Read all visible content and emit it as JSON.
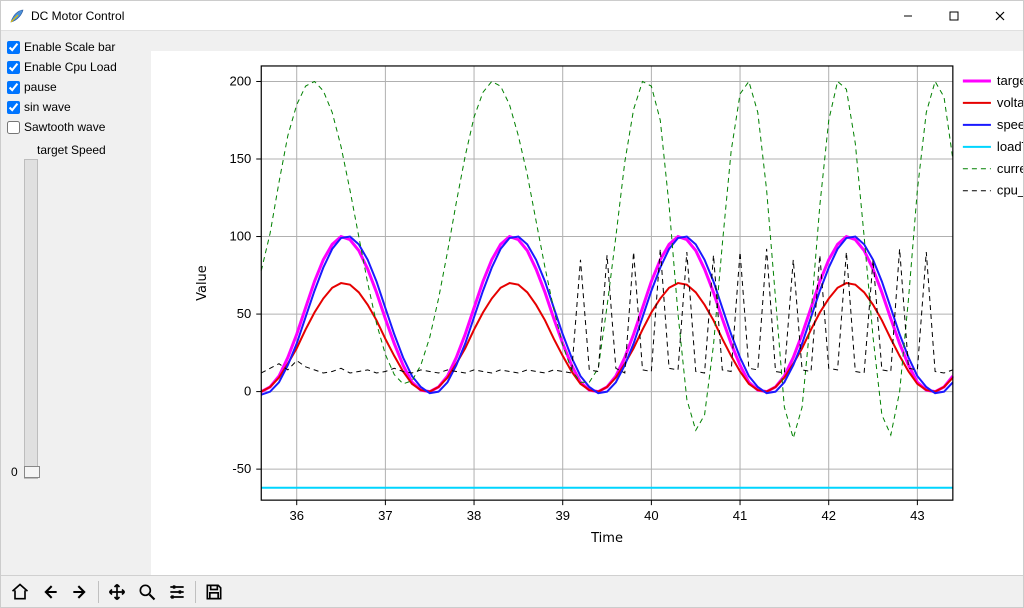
{
  "window": {
    "title": "DC Motor Control"
  },
  "sidebar": {
    "checkboxes": [
      {
        "label": "Enable Scale bar",
        "checked": true
      },
      {
        "label": "Enable Cpu Load",
        "checked": true
      },
      {
        "label": "pause",
        "checked": true
      },
      {
        "label": "sin wave",
        "checked": true
      },
      {
        "label": "Sawtooth wave",
        "checked": false
      }
    ],
    "slider": {
      "label": "target Speed",
      "value": "0"
    }
  },
  "legend": {
    "entries": [
      {
        "name": "target",
        "color": "#ff00ff",
        "style": "solid",
        "width": 3
      },
      {
        "name": "voltag",
        "color": "#e60000",
        "style": "solid",
        "width": 2
      },
      {
        "name": "speed",
        "color": "#1a1aff",
        "style": "solid",
        "width": 2
      },
      {
        "name": "loadTo",
        "color": "#00d5ff",
        "style": "solid",
        "width": 2
      },
      {
        "name": "curren",
        "color": "#008000",
        "style": "dash",
        "width": 1
      },
      {
        "name": "cpu_lo",
        "color": "#000000",
        "style": "dash",
        "width": 1
      }
    ]
  },
  "axes": {
    "xlabel": "Time",
    "ylabel": "Value",
    "xticks": [
      "36",
      "37",
      "38",
      "39",
      "40",
      "41",
      "42",
      "43"
    ],
    "yticks": [
      "-50",
      "0",
      "50",
      "100",
      "150",
      "200"
    ]
  },
  "chart_data": {
    "type": "line",
    "xlabel": "Time",
    "ylabel": "Value",
    "xlim": [
      35.6,
      43.4
    ],
    "ylim": [
      -70,
      210
    ],
    "x": [
      35.6,
      35.7,
      35.8,
      35.9,
      36.0,
      36.1,
      36.2,
      36.3,
      36.4,
      36.5,
      36.6,
      36.7,
      36.8,
      36.9,
      37.0,
      37.1,
      37.2,
      37.3,
      37.4,
      37.5,
      37.6,
      37.7,
      37.8,
      37.9,
      38.0,
      38.1,
      38.2,
      38.3,
      38.4,
      38.5,
      38.6,
      38.7,
      38.8,
      38.9,
      39.0,
      39.1,
      39.2,
      39.3,
      39.4,
      39.5,
      39.6,
      39.7,
      39.8,
      39.9,
      40.0,
      40.1,
      40.2,
      40.3,
      40.4,
      40.5,
      40.6,
      40.7,
      40.8,
      40.9,
      41.0,
      41.1,
      41.2,
      41.3,
      41.4,
      41.5,
      41.6,
      41.7,
      41.8,
      41.9,
      42.0,
      42.1,
      42.2,
      42.3,
      42.4,
      42.5,
      42.6,
      42.7,
      42.8,
      42.9,
      43.0,
      43.1,
      43.2,
      43.3,
      43.4
    ],
    "series": [
      {
        "name": "target",
        "color": "#ff00ff",
        "style": "solid",
        "width": 3,
        "values": [
          0,
          3,
          10,
          22,
          37,
          54,
          71,
          85,
          95,
          100,
          98,
          91,
          79,
          64,
          47,
          31,
          17,
          6,
          1,
          0,
          3,
          10,
          22,
          37,
          54,
          71,
          85,
          95,
          100,
          98,
          91,
          79,
          64,
          47,
          31,
          17,
          6,
          1,
          0,
          3,
          10,
          22,
          37,
          54,
          71,
          85,
          95,
          100,
          98,
          91,
          79,
          64,
          47,
          31,
          17,
          6,
          1,
          0,
          3,
          10,
          22,
          37,
          54,
          71,
          85,
          95,
          100,
          98,
          91,
          79,
          64,
          47,
          31,
          17,
          6,
          1,
          0,
          3,
          10
        ]
      },
      {
        "name": "voltage",
        "color": "#e60000",
        "style": "solid",
        "width": 2,
        "values": [
          0,
          3,
          9,
          18,
          28,
          40,
          51,
          60,
          67,
          70,
          69,
          64,
          56,
          46,
          34,
          23,
          13,
          5,
          1,
          0,
          3,
          9,
          18,
          28,
          40,
          51,
          60,
          67,
          70,
          69,
          64,
          56,
          46,
          34,
          23,
          13,
          5,
          1,
          0,
          3,
          9,
          18,
          28,
          40,
          51,
          60,
          67,
          70,
          69,
          64,
          56,
          46,
          34,
          23,
          13,
          5,
          1,
          0,
          3,
          9,
          18,
          28,
          40,
          51,
          60,
          67,
          70,
          69,
          64,
          56,
          46,
          34,
          23,
          13,
          5,
          1,
          0,
          3,
          9
        ]
      },
      {
        "name": "speed",
        "color": "#1a1aff",
        "style": "solid",
        "width": 2,
        "values": [
          -2,
          0,
          6,
          17,
          31,
          48,
          65,
          80,
          92,
          99,
          100,
          95,
          85,
          71,
          54,
          37,
          22,
          10,
          3,
          -1,
          0,
          6,
          17,
          31,
          48,
          65,
          80,
          92,
          99,
          100,
          95,
          85,
          71,
          54,
          37,
          22,
          10,
          3,
          -1,
          0,
          6,
          17,
          31,
          48,
          65,
          80,
          92,
          99,
          100,
          95,
          85,
          71,
          54,
          37,
          22,
          10,
          3,
          -1,
          0,
          6,
          17,
          31,
          48,
          65,
          80,
          92,
          99,
          100,
          95,
          85,
          71,
          54,
          37,
          22,
          10,
          3,
          -1,
          0,
          6
        ]
      },
      {
        "name": "loadTorque",
        "color": "#00d5ff",
        "style": "solid",
        "width": 2,
        "values": [
          -62,
          -62,
          -62,
          -62,
          -62,
          -62,
          -62,
          -62,
          -62,
          -62,
          -62,
          -62,
          -62,
          -62,
          -62,
          -62,
          -62,
          -62,
          -62,
          -62,
          -62,
          -62,
          -62,
          -62,
          -62,
          -62,
          -62,
          -62,
          -62,
          -62,
          -62,
          -62,
          -62,
          -62,
          -62,
          -62,
          -62,
          -62,
          -62,
          -62,
          -62,
          -62,
          -62,
          -62,
          -62,
          -62,
          -62,
          -62,
          -62,
          -62,
          -62,
          -62,
          -62,
          -62,
          -62,
          -62,
          -62,
          -62,
          -62,
          -62,
          -62,
          -62,
          -62,
          -62,
          -62,
          -62,
          -62,
          -62,
          -62,
          -62,
          -62,
          -62,
          -62,
          -62,
          -62,
          -62,
          -62,
          -62,
          -62
        ]
      },
      {
        "name": "current",
        "color": "#008000",
        "style": "dash",
        "width": 1,
        "values": [
          78,
          102,
          135,
          165,
          185,
          197,
          200,
          194,
          180,
          158,
          130,
          100,
          70,
          44,
          24,
          11,
          5,
          7,
          17,
          35,
          60,
          90,
          122,
          152,
          177,
          193,
          200,
          197,
          185,
          165,
          140,
          110,
          80,
          53,
          30,
          14,
          6,
          6,
          15,
          55,
          100,
          148,
          182,
          200,
          197,
          175,
          120,
          50,
          -5,
          -25,
          -15,
          30,
          95,
          155,
          192,
          200,
          180,
          130,
          60,
          -10,
          -30,
          -10,
          50,
          120,
          175,
          200,
          195,
          160,
          100,
          35,
          -15,
          -28,
          0,
          60,
          130,
          180,
          200,
          190,
          150
        ]
      },
      {
        "name": "cpu_load",
        "color": "#000000",
        "style": "dash",
        "width": 1,
        "values": [
          12,
          15,
          18,
          14,
          20,
          16,
          14,
          12,
          13,
          15,
          12,
          13,
          14,
          12,
          13,
          15,
          13,
          12,
          14,
          13,
          12,
          14,
          13,
          12,
          14,
          13,
          12,
          14,
          13,
          12,
          14,
          13,
          12,
          14,
          13,
          12,
          85,
          14,
          13,
          88,
          15,
          12,
          90,
          14,
          13,
          92,
          15,
          14,
          90,
          13,
          12,
          88,
          14,
          13,
          90,
          15,
          14,
          92,
          13,
          12,
          85,
          14,
          13,
          88,
          15,
          14,
          90,
          13,
          12,
          85,
          14,
          13,
          92,
          15,
          14,
          90,
          13,
          12,
          14
        ]
      }
    ]
  },
  "toolbar": {
    "home": "Home",
    "back": "Back",
    "forward": "Forward",
    "pan": "Pan",
    "zoom": "Zoom",
    "config": "Configure subplots",
    "save": "Save figure"
  }
}
